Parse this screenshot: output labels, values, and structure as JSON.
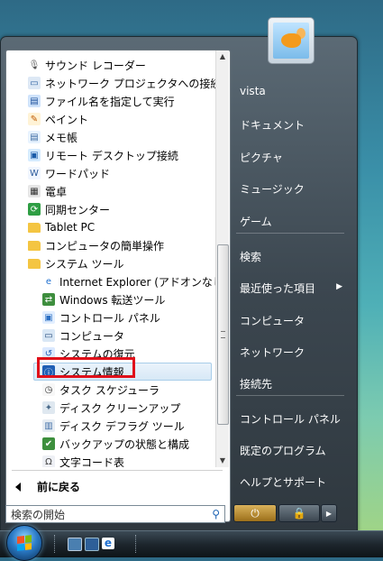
{
  "start_menu": {
    "programs": [
      {
        "label": "サウンド レコーダー",
        "icon": "microphone-icon",
        "level": 1
      },
      {
        "label": "ネットワーク プロジェクタへの接続",
        "icon": "projector-icon",
        "level": 1
      },
      {
        "label": "ファイル名を指定して実行",
        "icon": "run-icon",
        "level": 1
      },
      {
        "label": "ペイント",
        "icon": "paint-icon",
        "level": 1
      },
      {
        "label": "メモ帳",
        "icon": "notepad-icon",
        "level": 1
      },
      {
        "label": "リモート デスクトップ接続",
        "icon": "remote-desktop-icon",
        "level": 1
      },
      {
        "label": "ワードパッド",
        "icon": "wordpad-icon",
        "level": 1
      },
      {
        "label": "電卓",
        "icon": "calculator-icon",
        "level": 1
      },
      {
        "label": "同期センター",
        "icon": "sync-icon",
        "level": 1
      },
      {
        "label": "Tablet PC",
        "icon": "folder-icon",
        "level": 1
      },
      {
        "label": "コンピュータの簡単操作",
        "icon": "folder-icon",
        "level": 1
      },
      {
        "label": "システム ツール",
        "icon": "folder-icon",
        "level": 1
      },
      {
        "label": "Internet Explorer (アドオンなし)",
        "icon": "ie-icon",
        "level": 2
      },
      {
        "label": "Windows 転送ツール",
        "icon": "transfer-icon",
        "level": 2
      },
      {
        "label": "コントロール パネル",
        "icon": "control-panel-icon",
        "level": 2
      },
      {
        "label": "コンピュータ",
        "icon": "computer-icon",
        "level": 2
      },
      {
        "label": "システムの復元",
        "icon": "restore-icon",
        "level": 2
      },
      {
        "label": "システム情報",
        "icon": "system-info-icon",
        "level": 2,
        "selected": true
      },
      {
        "label": "タスク スケジューラ",
        "icon": "clock-icon",
        "level": 2
      },
      {
        "label": "ディスク クリーンアップ",
        "icon": "cleanup-icon",
        "level": 2
      },
      {
        "label": "ディスク デフラグ ツール",
        "icon": "defrag-icon",
        "level": 2
      },
      {
        "label": "バックアップの状態と構成",
        "icon": "backup-icon",
        "level": 2
      },
      {
        "label": "文字コード表",
        "icon": "charmap-icon",
        "level": 2
      }
    ],
    "back_label": "前に戻る",
    "search_placeholder": "検索の開始",
    "right_links": [
      {
        "label": "vista"
      },
      {
        "label": "ドキュメント"
      },
      {
        "label": "ピクチャ"
      },
      {
        "label": "ミュージック"
      },
      {
        "label": "ゲーム"
      },
      {
        "label": "検索"
      },
      {
        "label": "最近使った項目",
        "submenu": true
      },
      {
        "label": "コンピュータ"
      },
      {
        "label": "ネットワーク"
      },
      {
        "label": "接続先"
      },
      {
        "label": "コントロール パネル"
      },
      {
        "label": "既定のプログラム"
      },
      {
        "label": "ヘルプとサポート"
      }
    ]
  },
  "colors": {
    "highlight_box": "#e0101a",
    "menu_dark": "#3c4750",
    "selected_bg": "#d7e8f6"
  }
}
